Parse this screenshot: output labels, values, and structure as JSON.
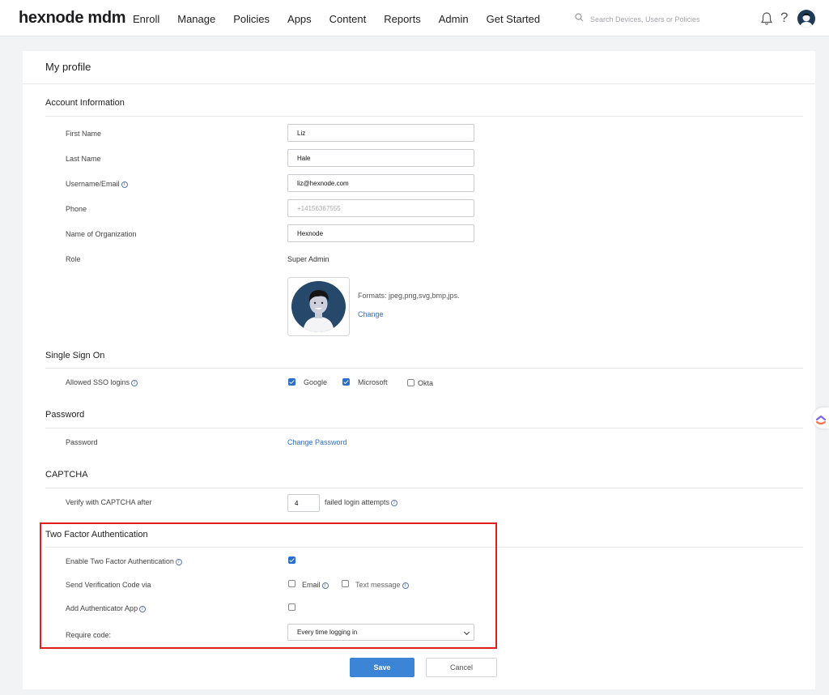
{
  "brand": {
    "logo_text": "hexnode mdm"
  },
  "nav": {
    "items": [
      "Enroll",
      "Manage",
      "Policies",
      "Apps",
      "Content",
      "Reports",
      "Admin",
      "Get Started"
    ]
  },
  "search": {
    "placeholder": "Search Devices, Users or Policies",
    "icon": "search-icon"
  },
  "header_icons": {
    "notifications": "bell-icon",
    "help": "?",
    "profile": "avatar"
  },
  "page": {
    "title": "My profile"
  },
  "account": {
    "heading": "Account Information",
    "first_name_label": "First Name",
    "first_name": "Liz",
    "last_name_label": "Last Name",
    "last_name": "Hale",
    "username_label": "Username/Email",
    "username": "liz@hexnode.com",
    "phone_label": "Phone",
    "phone_placeholder": "+14156367555",
    "org_label": "Name of Organization",
    "org": "Hexnode",
    "role_label": "Role",
    "role": "Super Admin",
    "formats": "Formats: jpeg,png,svg,bmp,jps.",
    "change_label": "Change"
  },
  "sso": {
    "heading": "Single Sign On",
    "allowed_label": "Allowed SSO logins",
    "options": [
      {
        "label": "Google",
        "checked": true
      },
      {
        "label": "Microsoft",
        "checked": true
      },
      {
        "label": "Okta",
        "checked": false
      }
    ]
  },
  "password": {
    "heading": "Password",
    "label": "Password",
    "change_link": "Change Password"
  },
  "captcha": {
    "heading": "CAPTCHA",
    "label": "Verify with CAPTCHA after",
    "value": "4",
    "suffix": "failed login attempts"
  },
  "tfa": {
    "heading": "Two Factor Authentication",
    "enable_label": "Enable Two Factor Authentication",
    "enable_checked": true,
    "send_label": "Send Verification Code via",
    "email_label": "Email",
    "email_checked": false,
    "sms_label": "Text message",
    "sms_checked": false,
    "app_label": "Add Authenticator App",
    "app_checked": false,
    "require_label": "Require code:",
    "require_value": "Every time logging in"
  },
  "actions": {
    "save": "Save",
    "cancel": "Cancel"
  },
  "colors": {
    "accent": "#3c84d6",
    "highlight": "#e01e1e",
    "link": "#2e6fc0"
  }
}
